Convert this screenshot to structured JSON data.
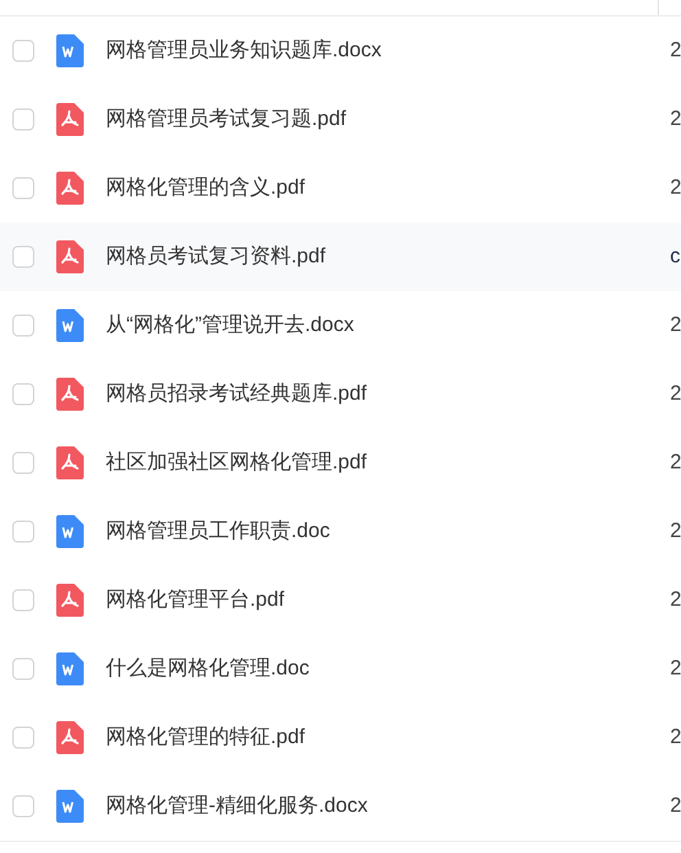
{
  "files": [
    {
      "name": "网格管理员业务知识题库.docx",
      "kind": "word",
      "column_2": "2",
      "checked": false,
      "hovered": false
    },
    {
      "name": "网格管理员考试复习题.pdf",
      "kind": "pdf",
      "column_2": "2",
      "checked": false,
      "hovered": false
    },
    {
      "name": "网格化管理的含义.pdf",
      "kind": "pdf",
      "column_2": "2",
      "checked": false,
      "hovered": false
    },
    {
      "name": "网格员考试复习资料.pdf",
      "kind": "pdf",
      "column_2": "c",
      "checked": false,
      "hovered": true
    },
    {
      "name": "从“网格化”管理说开去.docx",
      "kind": "word",
      "column_2": "2",
      "checked": false,
      "hovered": false
    },
    {
      "name": "网格员招录考试经典题库.pdf",
      "kind": "pdf",
      "column_2": "2",
      "checked": false,
      "hovered": false
    },
    {
      "name": "社区加强社区网格化管理.pdf",
      "kind": "pdf",
      "column_2": "2",
      "checked": false,
      "hovered": false
    },
    {
      "name": "网格管理员工作职责.doc",
      "kind": "word",
      "column_2": "2",
      "checked": false,
      "hovered": false
    },
    {
      "name": "网格化管理平台.pdf",
      "kind": "pdf",
      "column_2": "2",
      "checked": false,
      "hovered": false
    },
    {
      "name": "什么是网格化管理.doc",
      "kind": "word",
      "column_2": "2",
      "checked": false,
      "hovered": false
    },
    {
      "name": "网格化管理的特征.pdf",
      "kind": "pdf",
      "column_2": "2",
      "checked": false,
      "hovered": false
    },
    {
      "name": "网格化管理-精细化服务.docx",
      "kind": "word",
      "column_2": "2",
      "checked": false,
      "hovered": false
    }
  ]
}
